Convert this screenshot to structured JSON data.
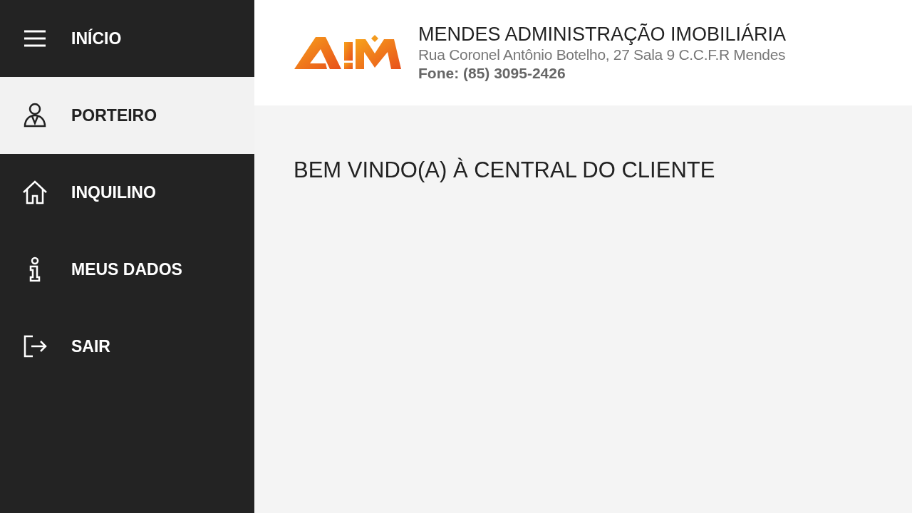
{
  "sidebar": {
    "items": [
      {
        "label": "INÍCIO",
        "selected": false
      },
      {
        "label": "PORTEIRO",
        "selected": true
      },
      {
        "label": "INQUILINO",
        "selected": false
      },
      {
        "label": "MEUS DADOS",
        "selected": false
      },
      {
        "label": "SAIR",
        "selected": false
      }
    ]
  },
  "header": {
    "company": "MENDES ADMINISTRAÇÃO IMOBILIÁRIA",
    "address": "Rua Coronel Antônio Botelho, 27 Sala 9 C.C.F.R Mendes",
    "phone": "Fone: (85) 3095-2426"
  },
  "main": {
    "title": "BEM VINDO(A) À CENTRAL DO CLIENTE"
  }
}
